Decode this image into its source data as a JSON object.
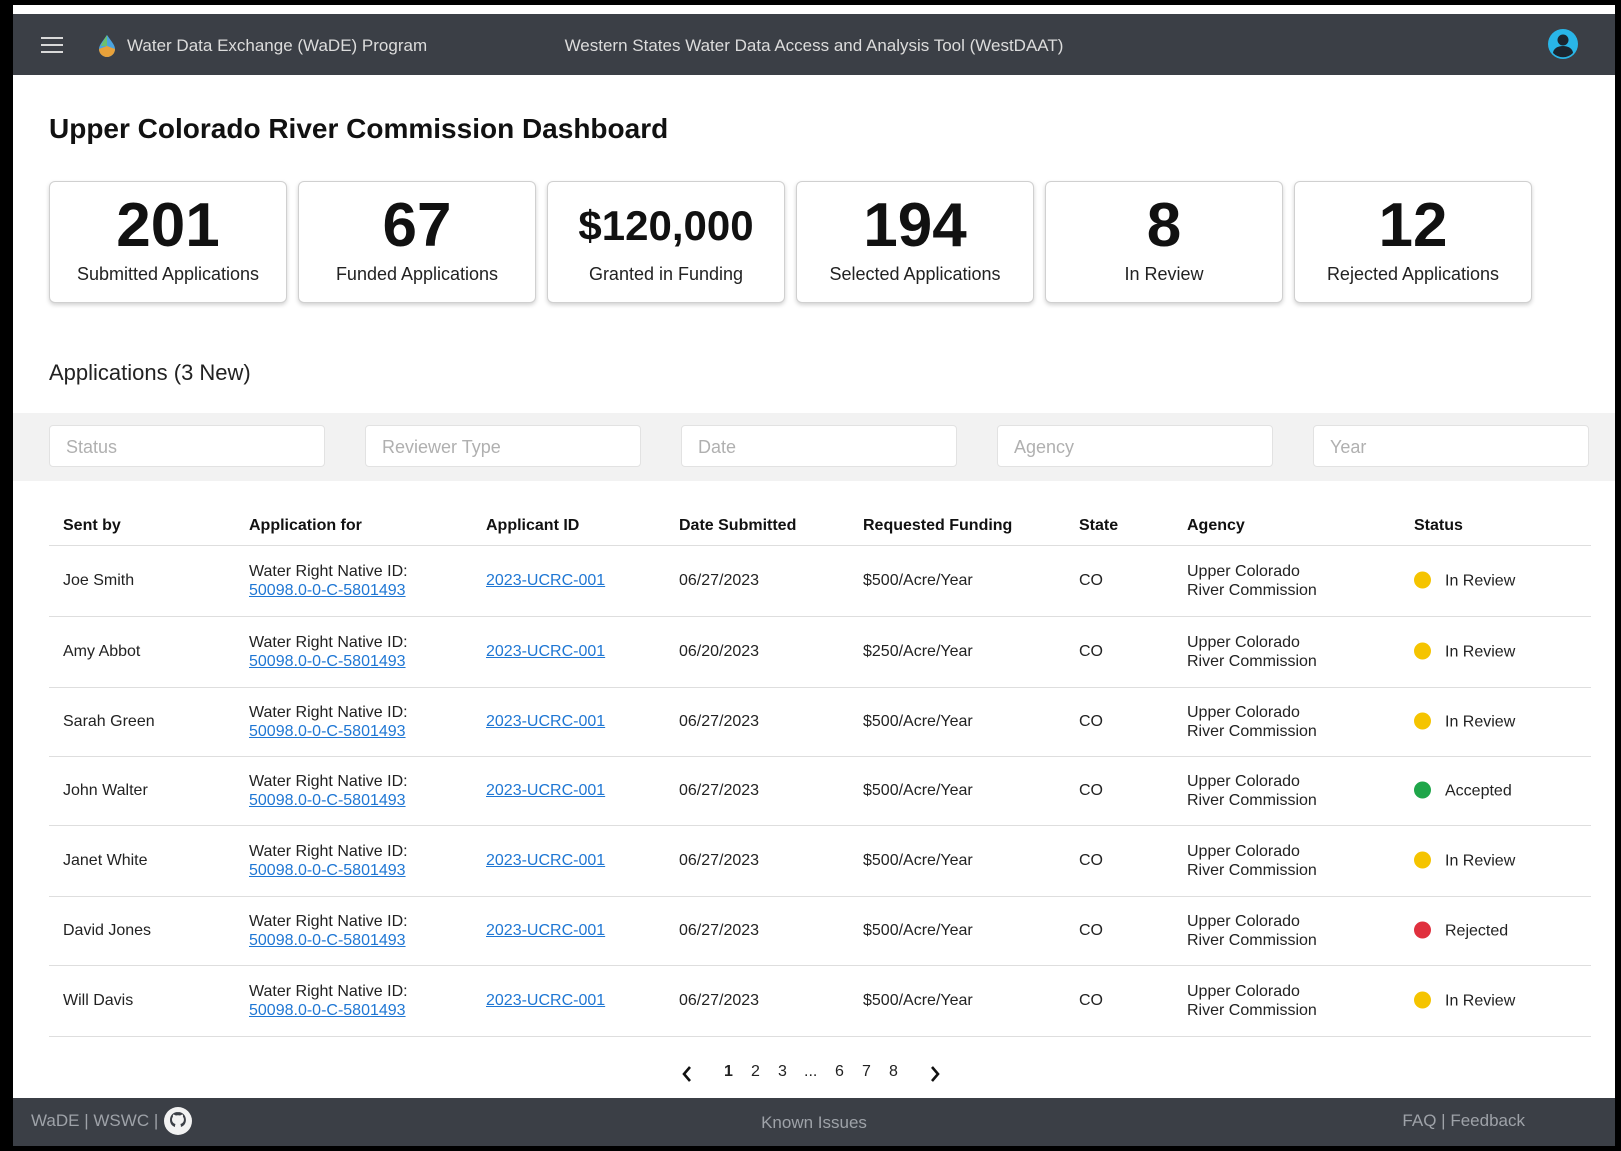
{
  "header": {
    "brand": "Water Data Exchange (WaDE) Program",
    "app_title": "Western States Water Data Access and Analysis Tool (WestDAAT)"
  },
  "page_title": "Upper Colorado River Commission Dashboard",
  "stats": [
    {
      "value": "201",
      "label": "Submitted Applications"
    },
    {
      "value": "67",
      "label": "Funded Applications"
    },
    {
      "value": "$120,000",
      "label": "Granted in Funding"
    },
    {
      "value": "194",
      "label": "Selected Applications"
    },
    {
      "value": "8",
      "label": "In Review"
    },
    {
      "value": "12",
      "label": "Rejected Applications"
    }
  ],
  "applications_title": "Applications (3 New)",
  "filters": {
    "status": "Status",
    "reviewer_type": "Reviewer Type",
    "date": "Date",
    "agency": "Agency",
    "year": "Year"
  },
  "table": {
    "headers": {
      "sent_by": "Sent by",
      "application_for": "Application for",
      "applicant_id": "Applicant ID",
      "date_submitted": "Date Submitted",
      "requested_funding": "Requested Funding",
      "state": "State",
      "agency": "Agency",
      "status": "Status"
    },
    "rows": [
      {
        "sent_by": "Joe Smith",
        "app_label": "Water Right Native ID:",
        "app_id": "50098.0-0-C-5801493",
        "applicant_id": "2023-UCRC-001",
        "date": "06/27/2023",
        "funding": "$500/Acre/Year",
        "state": "CO",
        "agency_1": "Upper Colorado",
        "agency_2": "River Commission",
        "status": "In Review"
      },
      {
        "sent_by": "Amy Abbot",
        "app_label": "Water Right Native ID:",
        "app_id": "50098.0-0-C-5801493",
        "applicant_id": "2023-UCRC-001",
        "date": "06/20/2023",
        "funding": "$250/Acre/Year",
        "state": "CO",
        "agency_1": "Upper Colorado",
        "agency_2": "River Commission",
        "status": "In Review"
      },
      {
        "sent_by": "Sarah Green",
        "app_label": "Water Right Native ID:",
        "app_id": "50098.0-0-C-5801493",
        "applicant_id": "2023-UCRC-001",
        "date": "06/27/2023",
        "funding": "$500/Acre/Year",
        "state": "CO",
        "agency_1": "Upper Colorado",
        "agency_2": "River Commission",
        "status": "In Review"
      },
      {
        "sent_by": "John Walter",
        "app_label": "Water Right Native ID:",
        "app_id": "50098.0-0-C-5801493",
        "applicant_id": "2023-UCRC-001",
        "date": "06/27/2023",
        "funding": "$500/Acre/Year",
        "state": "CO",
        "agency_1": "Upper Colorado",
        "agency_2": "River Commission",
        "status": "Accepted"
      },
      {
        "sent_by": "Janet White",
        "app_label": "Water Right Native ID:",
        "app_id": "50098.0-0-C-5801493",
        "applicant_id": "2023-UCRC-001",
        "date": "06/27/2023",
        "funding": "$500/Acre/Year",
        "state": "CO",
        "agency_1": "Upper Colorado",
        "agency_2": "River Commission",
        "status": "In Review"
      },
      {
        "sent_by": "David Jones",
        "app_label": "Water Right Native ID:",
        "app_id": "50098.0-0-C-5801493",
        "applicant_id": "2023-UCRC-001",
        "date": "06/27/2023",
        "funding": "$500/Acre/Year",
        "state": "CO",
        "agency_1": "Upper Colorado",
        "agency_2": "River Commission",
        "status": "Rejected"
      },
      {
        "sent_by": "Will Davis",
        "app_label": "Water Right Native ID:",
        "app_id": "50098.0-0-C-5801493",
        "applicant_id": "2023-UCRC-001",
        "date": "06/27/2023",
        "funding": "$500/Acre/Year",
        "state": "CO",
        "agency_1": "Upper Colorado",
        "agency_2": "River Commission",
        "status": "In Review"
      }
    ]
  },
  "status_colors": {
    "In Review": "#f5c400",
    "Accepted": "#1fa64a",
    "Rejected": "#e0303e"
  },
  "pagination": {
    "pages": [
      "1",
      "2",
      "3",
      "...",
      "6",
      "7",
      "8"
    ],
    "current": "1"
  },
  "footer": {
    "wade": "WaDE",
    "wswc": "WSWC",
    "separator": "|",
    "known_issues": "Known Issues",
    "faq": "FAQ",
    "feedback": "Feedback"
  },
  "icons": {
    "menu": "menu-icon",
    "logo": "water-drop-logo-icon",
    "user": "user-account-icon",
    "github": "github-icon",
    "prev": "chevron-left-icon",
    "next": "chevron-right-icon"
  },
  "colors": {
    "header_bg": "#3b3f46",
    "link": "#1f77d4"
  }
}
